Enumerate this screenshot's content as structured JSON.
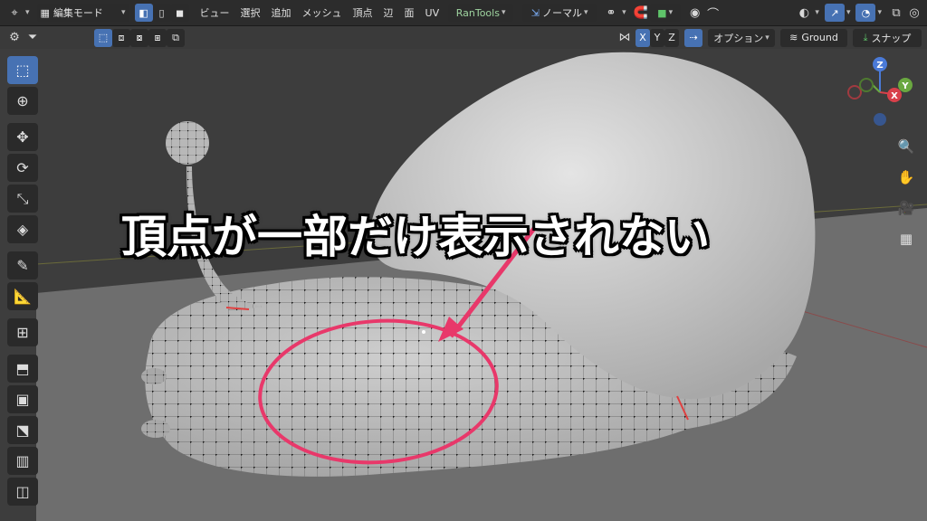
{
  "header": {
    "mode_label": "編集モード",
    "menus": [
      "ビュー",
      "選択",
      "追加",
      "メッシュ",
      "頂点",
      "辺",
      "面",
      "UV"
    ],
    "addon_label": "RanTools",
    "orientation_label": "ノーマル"
  },
  "subheader": {
    "axis_x": "X",
    "axis_y": "Y",
    "axis_z": "Z",
    "options_label": "オプション",
    "snap_target": "Ground",
    "snap_label": "スナップ"
  },
  "gizmo": {
    "z": "Z",
    "y": "Y",
    "x": "X"
  },
  "overlay": {
    "caption": "頂点が一部だけ表示されない"
  },
  "colors": {
    "accent": "#4772b3",
    "annotation": "#e8386a",
    "header_bg": "#2c2c2c"
  }
}
